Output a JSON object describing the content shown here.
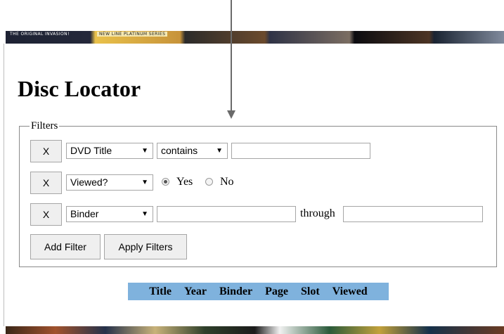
{
  "banner": {
    "left_text": "THE ORIGINAL INVASION!",
    "second_text": "NEW LINE PLATINUM SERIES"
  },
  "page_title": "Disc Locator",
  "filters": {
    "legend": "Filters",
    "rows": [
      {
        "remove_label": "X",
        "field": "DVD Title",
        "operator": "contains",
        "value": ""
      },
      {
        "remove_label": "X",
        "field": "Viewed?",
        "radio_options": [
          "Yes",
          "No"
        ],
        "selected": "Yes"
      },
      {
        "remove_label": "X",
        "field": "Binder",
        "from_value": "",
        "through_label": "through",
        "to_value": ""
      }
    ],
    "add_filter_label": "Add Filter",
    "apply_filters_label": "Apply Filters"
  },
  "results": {
    "columns": [
      "Title",
      "Year",
      "Binder",
      "Page",
      "Slot",
      "Viewed"
    ],
    "header_color": "#7fb2dd"
  },
  "icons": {
    "dropdown": "caret-down-icon",
    "annotation": "arrow-down-icon"
  }
}
